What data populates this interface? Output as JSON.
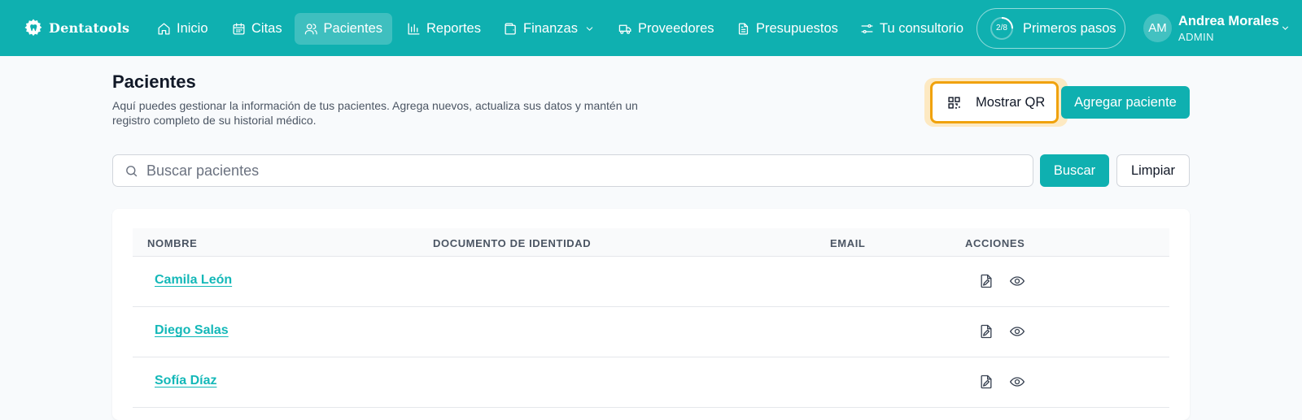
{
  "brand": {
    "name": "Dentatools"
  },
  "nav": {
    "items": [
      {
        "label": "Inicio",
        "icon": "home-icon"
      },
      {
        "label": "Citas",
        "icon": "calendar-icon"
      },
      {
        "label": "Pacientes",
        "icon": "users-icon",
        "active": true
      },
      {
        "label": "Reportes",
        "icon": "bar-chart-icon"
      },
      {
        "label": "Finanzas",
        "icon": "wallet-icon",
        "dropdown": true
      },
      {
        "label": "Proveedores",
        "icon": "truck-icon"
      },
      {
        "label": "Presupuestos",
        "icon": "document-icon"
      },
      {
        "label": "Tu consultorio",
        "icon": "settings-sliders-icon"
      }
    ],
    "onboarding": {
      "progress": "2/8",
      "label": "Primeros pasos"
    }
  },
  "user": {
    "initials": "AM",
    "name": "Andrea Morales",
    "role": "ADMIN"
  },
  "header": {
    "title": "Pacientes",
    "description": "Aquí puedes gestionar la información de tus pacientes. Agrega nuevos, actualiza sus datos y mantén un registro completo de su historial médico.",
    "qr_button": "Mostrar QR",
    "add_button": "Agregar paciente"
  },
  "search": {
    "placeholder": "Buscar pacientes",
    "value": "",
    "search_button": "Buscar",
    "clear_button": "Limpiar"
  },
  "table": {
    "columns": [
      "NOMBRE",
      "DOCUMENTO DE IDENTIDAD",
      "EMAIL",
      "ACCIONES"
    ],
    "rows": [
      {
        "name": "Camila León",
        "document": "",
        "email": ""
      },
      {
        "name": "Diego Salas",
        "document": "",
        "email": ""
      },
      {
        "name": "Sofía Díaz",
        "document": "",
        "email": ""
      }
    ]
  },
  "colors": {
    "primary": "#0fb0b0",
    "highlight": "#f0a20c",
    "link": "#14b8b8"
  }
}
